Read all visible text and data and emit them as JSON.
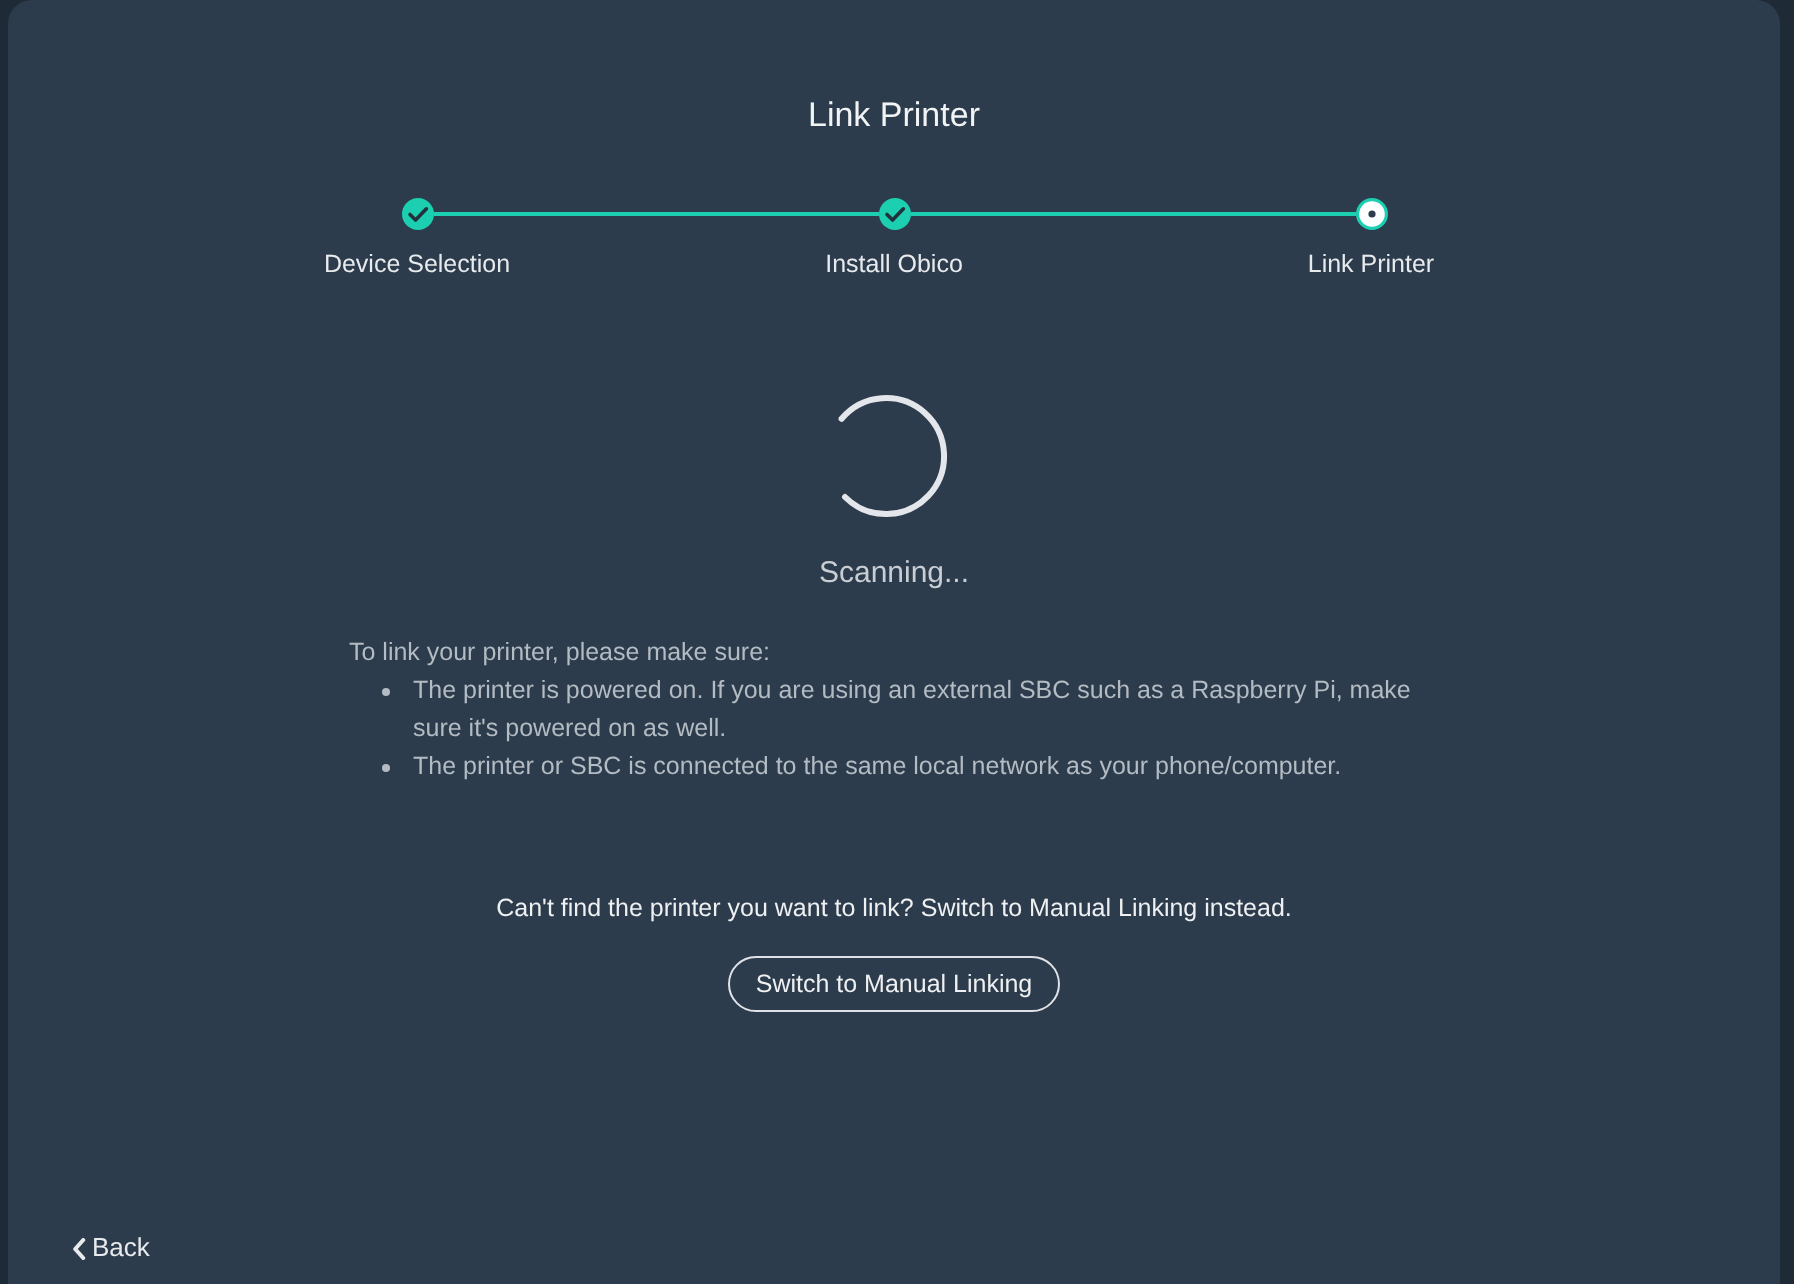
{
  "title": "Link Printer",
  "steps": [
    {
      "label": "Device Selection",
      "completed": true,
      "current": false
    },
    {
      "label": "Install Obico",
      "completed": true,
      "current": false
    },
    {
      "label": "Link Printer",
      "completed": false,
      "current": true
    }
  ],
  "status": {
    "text": "Scanning..."
  },
  "instructions": {
    "intro": "To link your printer, please make sure:",
    "items": [
      "The printer is powered on. If you are using an external SBC such as a Raspberry Pi, make sure it's powered on as well.",
      "The printer or SBC is connected to the same local network as your phone/computer."
    ]
  },
  "manual": {
    "prompt": "Can't find the printer you want to link? Switch to Manual Linking instead.",
    "button": "Switch to Manual Linking"
  },
  "back": {
    "label": "Back"
  }
}
